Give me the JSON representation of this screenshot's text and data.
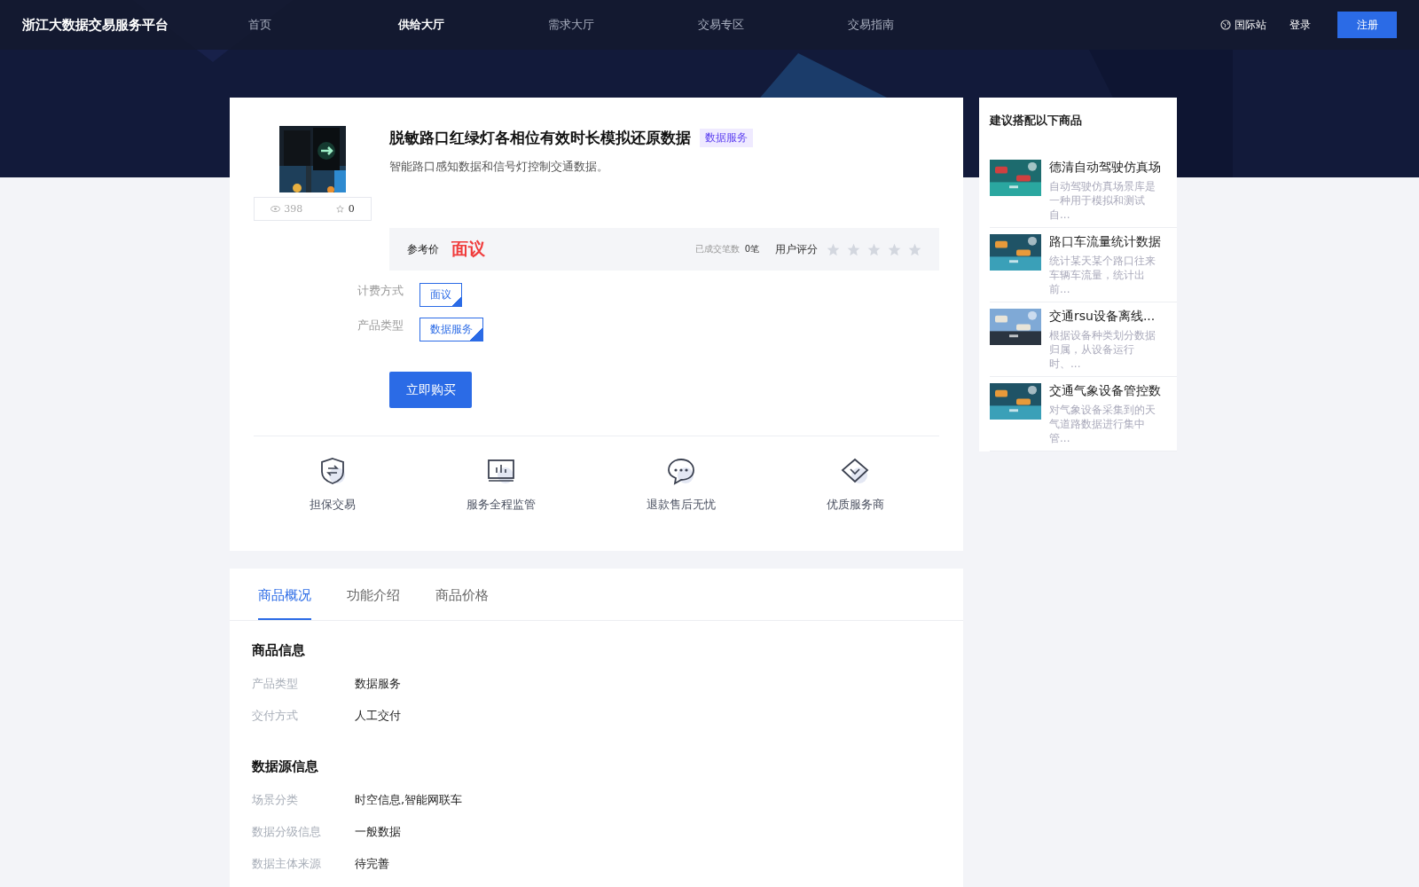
{
  "header": {
    "logo": "浙江大数据交易服务平台",
    "nav": [
      {
        "label": "首页",
        "selected": false
      },
      {
        "label": "供给大厅",
        "selected": true
      },
      {
        "label": "需求大厅",
        "selected": false
      },
      {
        "label": "交易专区",
        "selected": false
      },
      {
        "label": "交易指南",
        "selected": false
      }
    ],
    "intl": "国际站",
    "login": "登录",
    "register": "注册"
  },
  "product": {
    "title": "脱敏路口红绿灯各相位有效时长模拟还原数据",
    "tag": "数据服务",
    "subtitle": "智能路口感知数据和信号灯控制交通数据。",
    "views": "398",
    "favorites": "0",
    "price_label": "参考价",
    "price": "面议",
    "deals_label": "已成交笔数",
    "deals": "0笔",
    "rating_label": "用户评分",
    "stars": 0,
    "options": [
      {
        "label": "计费方式",
        "value": "面议"
      },
      {
        "label": "产品类型",
        "value": "数据服务"
      }
    ],
    "buy": "立即购买",
    "features": [
      {
        "kind": "shield",
        "label": "担保交易"
      },
      {
        "kind": "monitor",
        "label": "服务全程监管"
      },
      {
        "kind": "chat",
        "label": "退款售后无忧"
      },
      {
        "kind": "diamond",
        "label": "优质服务商"
      }
    ]
  },
  "tabs": [
    {
      "label": "商品概况",
      "selected": true
    },
    {
      "label": "功能介绍",
      "selected": false
    },
    {
      "label": "商品价格",
      "selected": false
    }
  ],
  "sections": [
    {
      "title": "商品信息",
      "rows": [
        {
          "label": "产品类型",
          "value": "数据服务"
        },
        {
          "label": "交付方式",
          "value": "人工交付"
        }
      ]
    },
    {
      "title": "数据源信息",
      "rows": [
        {
          "label": "场景分类",
          "value": "时空信息,智能网联车"
        },
        {
          "label": "数据分级信息",
          "value": "一般数据"
        },
        {
          "label": "数据主体来源",
          "value": "待完善"
        }
      ]
    }
  ],
  "suggest": {
    "title": "建议搭配以下商品",
    "items": [
      {
        "title": "德清自动驾驶仿真场",
        "desc": "自动驾驶仿真场景库是一种用于模拟和测试自..."
      },
      {
        "title": "路口车流量统计数据",
        "desc": "统计某天某个路口往来车辆车流量，统计出前..."
      },
      {
        "title": "交通rsu设备离线...",
        "desc": "根据设备种类划分数据归属，从设备运行时、..."
      },
      {
        "title": "交通气象设备管控数",
        "desc": "对气象设备采集到的天气道路数据进行集中管..."
      }
    ]
  }
}
